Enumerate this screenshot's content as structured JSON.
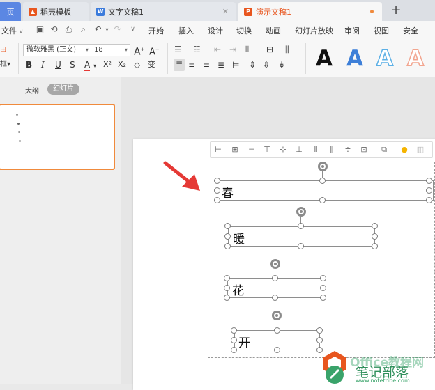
{
  "tabs": [
    {
      "label": "页",
      "kind": "home"
    },
    {
      "label": "稻壳模板",
      "kind": "docer"
    },
    {
      "label": "文字文稿1",
      "kind": "writer"
    },
    {
      "label": "演示文稿1",
      "kind": "presentation",
      "active": true
    }
  ],
  "new_tab_label": "+",
  "file_menu": "文件",
  "menus": [
    "开始",
    "插入",
    "设计",
    "切换",
    "动画",
    "幻灯片放映",
    "审阅",
    "视图",
    "安全"
  ],
  "ribbon": {
    "font_name": "微软雅黑 (正文)",
    "font_size": "18",
    "left_stub_labels": [
      "框▾"
    ],
    "wordart_letter": "A",
    "wordart_colors": [
      "#111111",
      "#3d7fd8",
      "#5cb0e6",
      "#f2a58f"
    ]
  },
  "left_panel": {
    "tab_outline": "大纲",
    "tab_slides": "幻灯片"
  },
  "textboxes": [
    "春",
    "暖",
    "花",
    "开"
  ],
  "watermark": {
    "brand": "Office教程网",
    "site": "笔记部落",
    "url": "www.notetribe.com"
  },
  "colors": {
    "accent_orange": "#f08a3c",
    "active_tab_text": "#e8561f",
    "home_tab": "#5b87e3",
    "arrow_red": "#e53935",
    "watermark_green": "#3aa36a"
  }
}
